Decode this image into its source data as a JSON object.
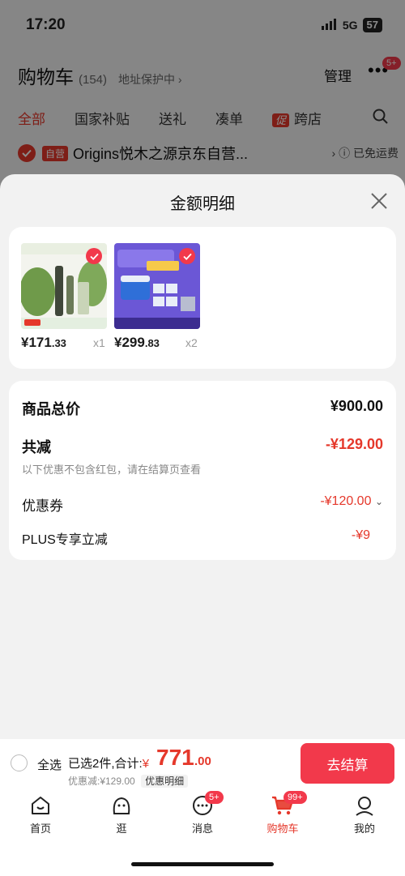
{
  "status_bar": {
    "time": "17:20",
    "network": "5G",
    "battery": "57"
  },
  "background": {
    "title": "购物车",
    "count": "(154)",
    "address": "地址保护中",
    "manage": "管理",
    "more_badge": "5+",
    "tabs": [
      "全部",
      "国家补贴",
      "送礼",
      "凑单"
    ],
    "promo_tag": "促",
    "promo_tab": "跨店",
    "shop_tag": "自营",
    "shop_name": "Origins悦木之源京东自营...",
    "free_shipping": "已免运费"
  },
  "sheet": {
    "title": "金额明细",
    "products": [
      {
        "price_int": "¥171",
        "price_dec": ".33",
        "qty": "x1"
      },
      {
        "price_int": "¥299",
        "price_dec": ".83",
        "qty": "x2"
      }
    ],
    "rows": {
      "total_label": "商品总价",
      "total_value": "¥900.00",
      "reduce_label": "共减",
      "reduce_value": "-¥129.00",
      "reduce_note": "以下优惠不包含红包，请在结算页查看",
      "coupon_label": "优惠券",
      "coupon_value": "-¥120.00",
      "plus_label": "PLUS专享立减",
      "plus_value": "-¥9"
    }
  },
  "checkout_bar": {
    "select_all": "全选",
    "selected_text": "已选2件,合计:",
    "yen": "¥",
    "total_int": "771",
    "total_dec": ".00",
    "discount_text": "优惠减:¥129.00",
    "detail_chip": "优惠明细",
    "checkout": "去结算"
  },
  "tabbar": {
    "items": [
      {
        "label": "首页",
        "icon": "home-icon"
      },
      {
        "label": "逛",
        "icon": "browse-icon"
      },
      {
        "label": "消息",
        "icon": "message-icon",
        "badge": "5+"
      },
      {
        "label": "购物车",
        "icon": "cart-icon",
        "badge": "99+"
      },
      {
        "label": "我的",
        "icon": "profile-icon"
      }
    ]
  },
  "colors": {
    "accent": "#e5382b",
    "badge": "#f2394b"
  }
}
